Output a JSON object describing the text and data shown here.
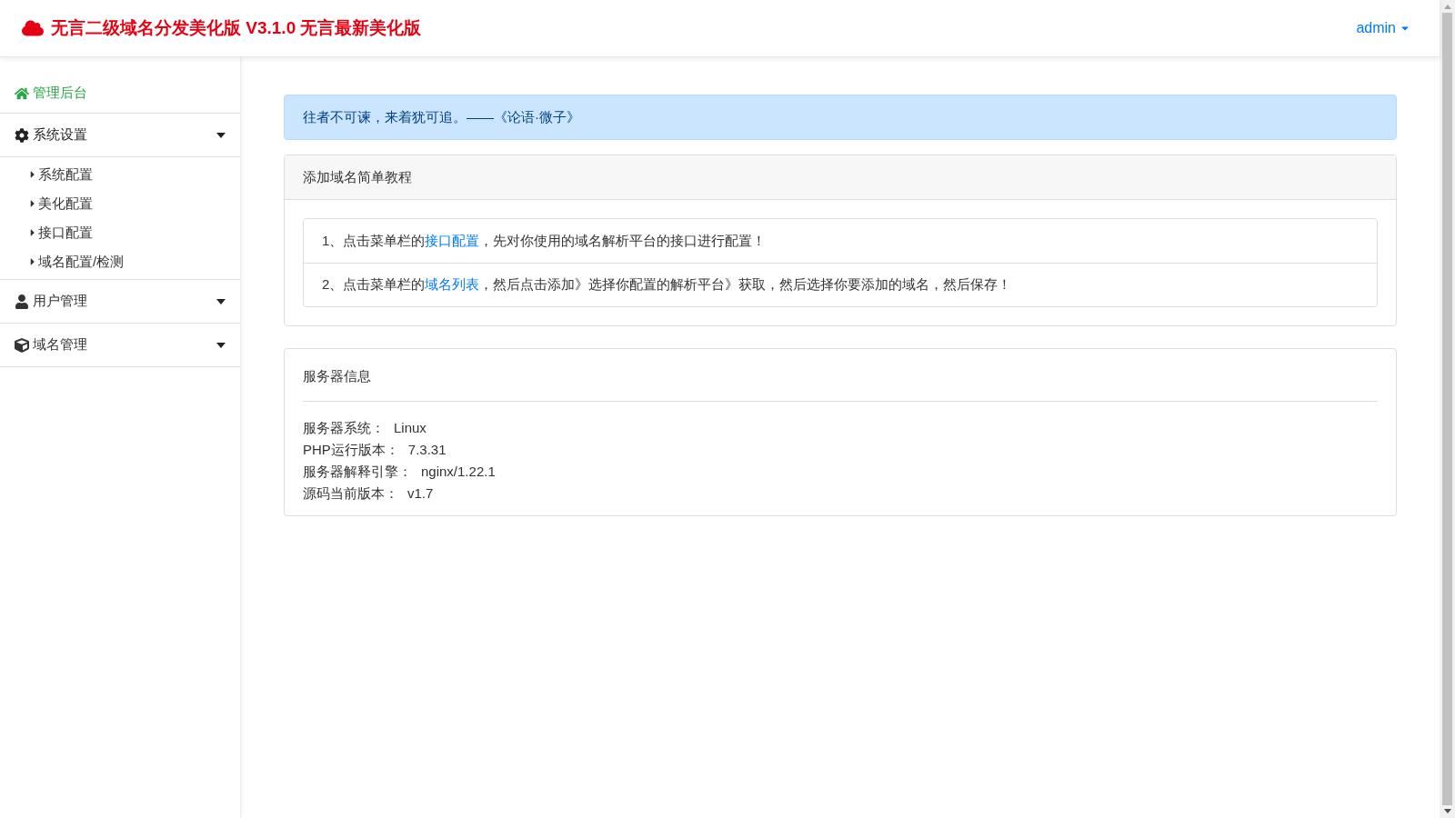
{
  "header": {
    "title": "无言二级域名分发美化版 V3.1.0 无言最新美化版",
    "user": "admin"
  },
  "sidebar": {
    "items": [
      {
        "kind": "home",
        "label": "管理后台"
      },
      {
        "kind": "group",
        "label": "系统设置",
        "expanded": true,
        "children": [
          {
            "label": "系统配置"
          },
          {
            "label": "美化配置"
          },
          {
            "label": "接口配置"
          },
          {
            "label": "域名配置/检测"
          }
        ]
      },
      {
        "kind": "group",
        "label": "用户管理",
        "expanded": false
      },
      {
        "kind": "group",
        "label": "域名管理",
        "expanded": false
      }
    ]
  },
  "alert": "往者不可谏，来着犹可追。——《论语·微子》",
  "tutorial": {
    "title": "添加域名简单教程",
    "steps": [
      {
        "before": "1、点击菜单栏的",
        "link": "接口配置",
        "after": "，先对你使用的域名解析平台的接口进行配置！"
      },
      {
        "before": "2、点击菜单栏的",
        "link": "域名列表",
        "after": "，然后点击添加》选择你配置的解析平台》获取，然后选择你要添加的域名，然后保存！"
      }
    ]
  },
  "server_info": {
    "title": "服务器信息",
    "rows": [
      {
        "label": "服务器系统：",
        "value": "Linux"
      },
      {
        "label": "PHP运行版本：",
        "value": "7.3.31"
      },
      {
        "label": "服务器解释引擎：",
        "value": "nginx/1.22.1"
      },
      {
        "label": "源码当前版本：",
        "value": "v1.7"
      }
    ]
  }
}
